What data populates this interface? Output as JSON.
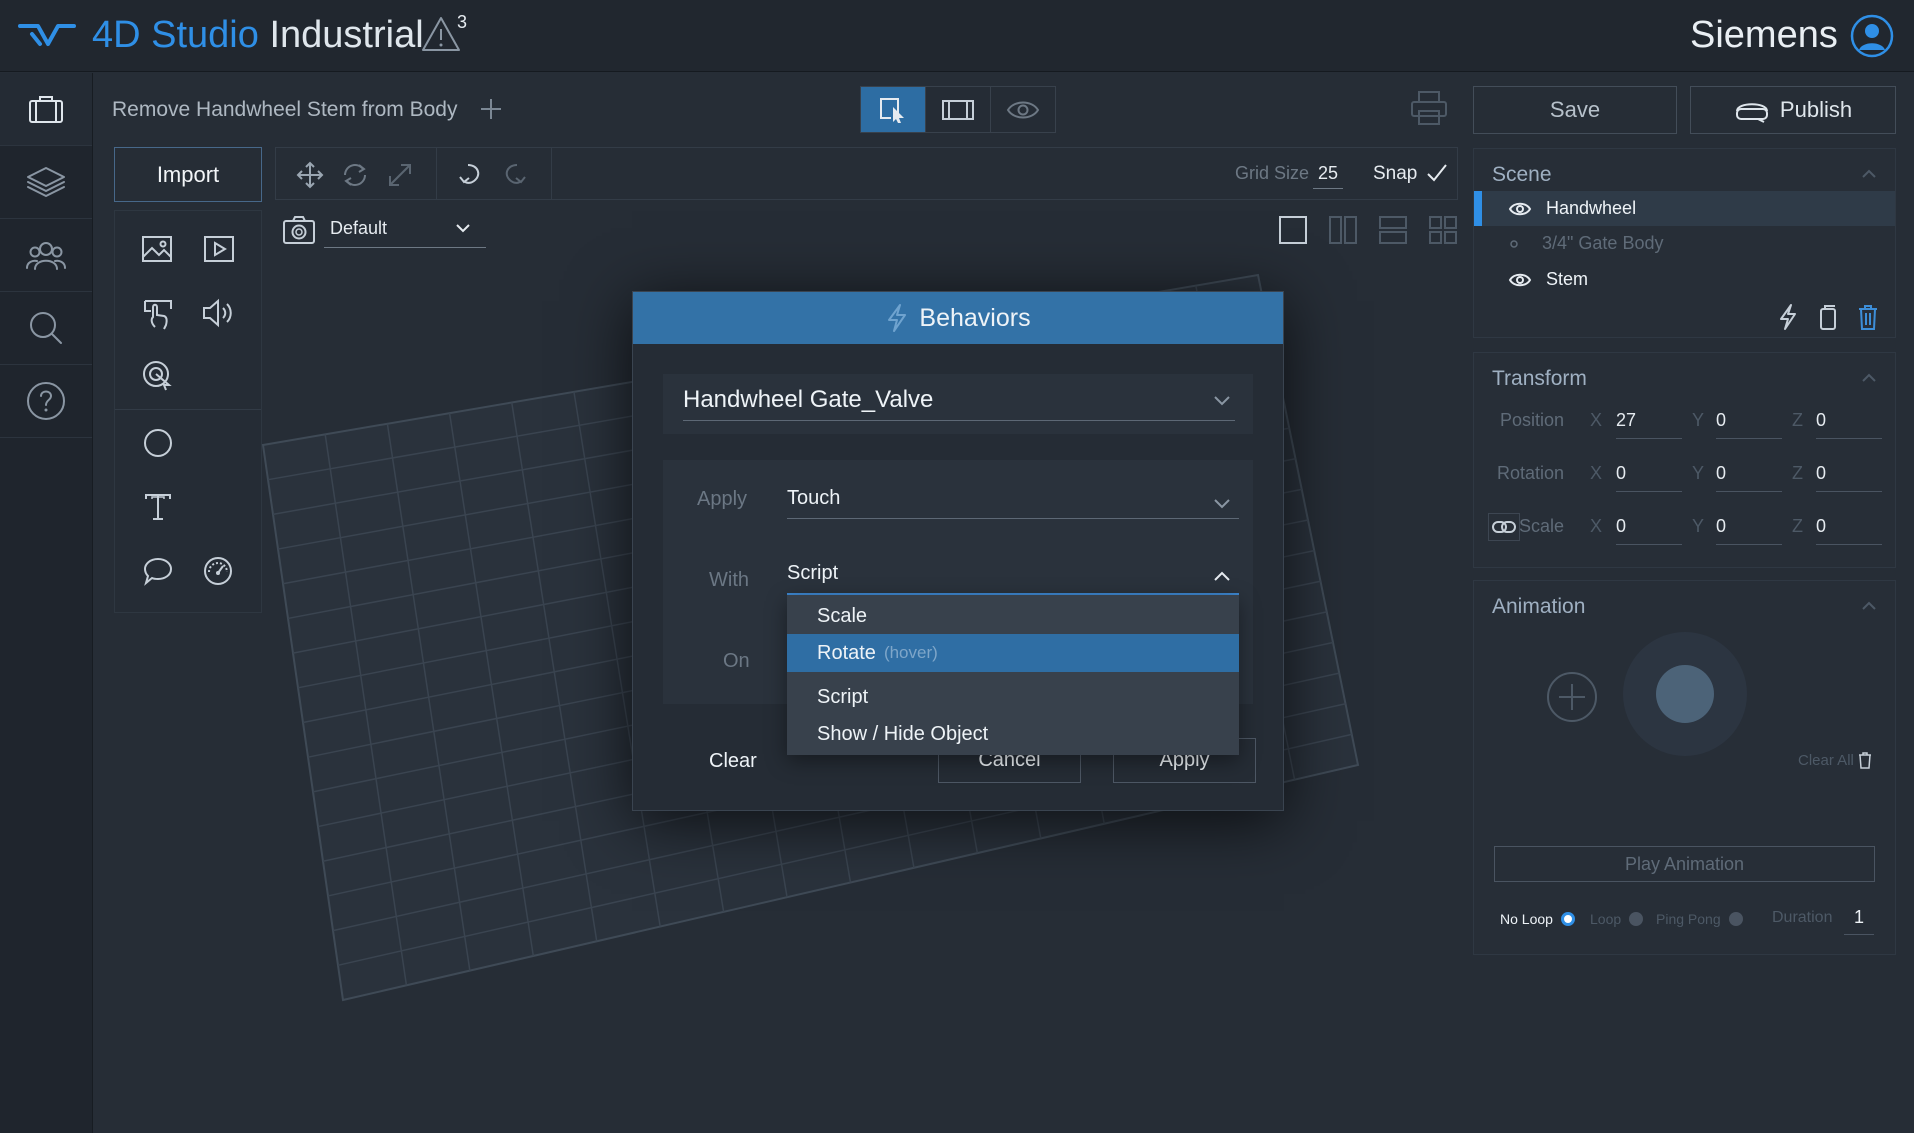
{
  "header": {
    "app_name_accent": "4D Studio",
    "app_name_rest": "Industrial",
    "warning_count": "3",
    "user_name": "Siemens"
  },
  "toolbar_top": {
    "scene_title": "Remove Handwheel Stem from Body",
    "save_label": "Save",
    "publish_label": "Publish"
  },
  "left_panel": {
    "import_label": "Import"
  },
  "editor_toolbar": {
    "grid_size_label": "Grid Size",
    "grid_size_value": "25",
    "snap_label": "Snap"
  },
  "camera": {
    "selected": "Default"
  },
  "scene_panel": {
    "title": "Scene",
    "items": [
      {
        "label": "Handwheel",
        "selected": true
      },
      {
        "label": "3/4\" Gate Body",
        "selected": false
      },
      {
        "label": "Stem",
        "selected": false
      }
    ]
  },
  "transform_panel": {
    "title": "Transform",
    "position_label": "Position",
    "rotation_label": "Rotation",
    "scale_label": "Scale",
    "axis_x": "X",
    "axis_y": "Y",
    "axis_z": "Z",
    "position": {
      "x": "27",
      "y": "0",
      "z": "0"
    },
    "rotation": {
      "x": "0",
      "y": "0",
      "z": "0"
    },
    "scale": {
      "x": "0",
      "y": "0",
      "z": "0"
    }
  },
  "animation_panel": {
    "title": "Animation",
    "clear_all_label": "Clear All",
    "play_label": "Play Animation",
    "no_loop_label": "No Loop",
    "loop_label": "Loop",
    "ping_pong_label": "Ping Pong",
    "duration_label": "Duration",
    "duration_value": "1"
  },
  "behaviors_modal": {
    "title": "Behaviors",
    "object_name": "Handwheel Gate_Valve",
    "apply_label": "Apply",
    "apply_value": "Touch",
    "with_label": "With",
    "with_value": "Script",
    "on_label": "On",
    "options": [
      {
        "label": "Scale",
        "hint": ""
      },
      {
        "label": "Rotate",
        "hint": "(hover)"
      },
      {
        "label": "Script",
        "hint": ""
      },
      {
        "label": "Show / Hide Object",
        "hint": ""
      }
    ],
    "clear_label": "Clear",
    "cancel_label": "Cancel",
    "apply_button_label": "Apply"
  },
  "colors": {
    "accent": "#2f8fe6",
    "modal_header": "#3372a7",
    "hover": "#2f6ea4"
  }
}
